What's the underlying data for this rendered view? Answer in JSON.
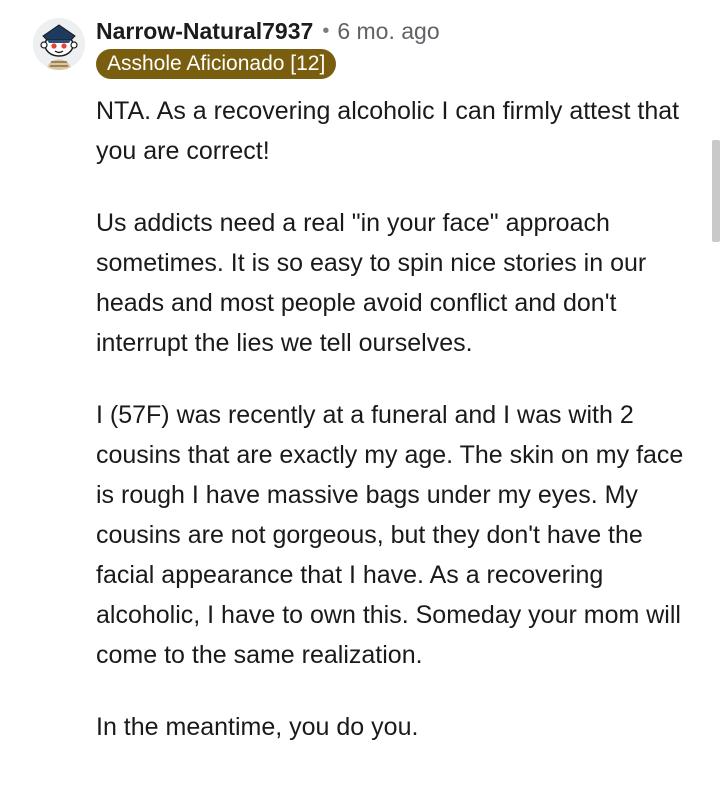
{
  "comment": {
    "author": "Narrow-Natural7937",
    "separator": "•",
    "age": "6 mo. ago",
    "flair": "Asshole Aficionado [12]",
    "avatar_icon": "snoo-avatar-icon",
    "paragraphs": [
      "NTA. As a recovering alcoholic I can firmly attest that you are correct!",
      "Us addicts need a real \"in your face\" approach sometimes. It is so easy to spin nice stories in our heads and most people avoid conflict and don't interrupt the lies we tell ourselves.",
      "I (57F) was recently at a funeral and I was with 2 cousins that are exactly my age. The skin on my face is rough I have massive bags under my eyes. My cousins are not gorgeous, but they don't have the facial appearance that I have. As a recovering alcoholic, I have to own this. Someday your mom will come to the same realization.",
      "In the meantime, you do you."
    ]
  },
  "colors": {
    "flair_background": "#7a5e10",
    "flair_text": "#ffffff",
    "username": "#1c1c1c",
    "meta": "#5f6266",
    "body_text": "#1a1a1b",
    "scrollbar": "#c9c9c9"
  }
}
